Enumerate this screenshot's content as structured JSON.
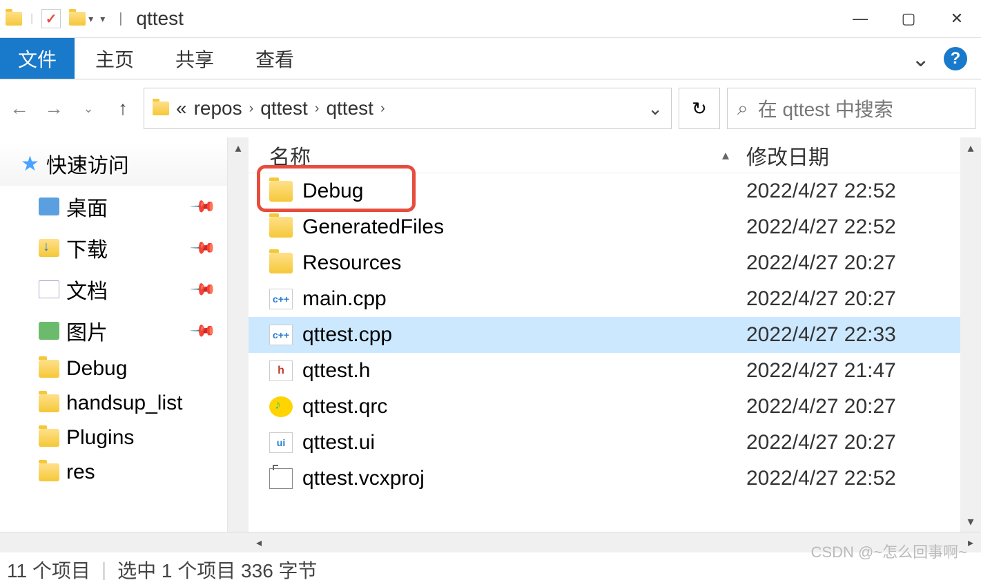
{
  "titlebar": {
    "title": "qttest"
  },
  "ribbon": {
    "file": "文件",
    "tabs": [
      "主页",
      "共享",
      "查看"
    ]
  },
  "nav": {
    "crumbs": [
      "repos",
      "qttest",
      "qttest"
    ],
    "search_placeholder": "在 qttest 中搜索"
  },
  "sidebar": {
    "quick_access": "快速访问",
    "items": [
      {
        "label": "桌面",
        "pinned": true,
        "ico": "desktop"
      },
      {
        "label": "下载",
        "pinned": true,
        "ico": "download"
      },
      {
        "label": "文档",
        "pinned": true,
        "ico": "doc"
      },
      {
        "label": "图片",
        "pinned": true,
        "ico": "pic"
      },
      {
        "label": "Debug",
        "pinned": false,
        "ico": "folder"
      },
      {
        "label": "handsup_list",
        "pinned": false,
        "ico": "folder"
      },
      {
        "label": "Plugins",
        "pinned": false,
        "ico": "folder"
      },
      {
        "label": "res",
        "pinned": false,
        "ico": "folder"
      }
    ]
  },
  "columns": {
    "name": "名称",
    "date": "修改日期"
  },
  "files": [
    {
      "name": "Debug",
      "date": "2022/4/27 22:52",
      "ico": "folder",
      "hl": true
    },
    {
      "name": "GeneratedFiles",
      "date": "2022/4/27 22:52",
      "ico": "folder"
    },
    {
      "name": "Resources",
      "date": "2022/4/27 20:27",
      "ico": "folder"
    },
    {
      "name": "main.cpp",
      "date": "2022/4/27 20:27",
      "ico": "cpp"
    },
    {
      "name": "qttest.cpp",
      "date": "2022/4/27 22:33",
      "ico": "cpp",
      "sel": true
    },
    {
      "name": "qttest.h",
      "date": "2022/4/27 21:47",
      "ico": "h"
    },
    {
      "name": "qttest.qrc",
      "date": "2022/4/27 20:27",
      "ico": "qrc"
    },
    {
      "name": "qttest.ui",
      "date": "2022/4/27 20:27",
      "ico": "ui"
    },
    {
      "name": "qttest.vcxproj",
      "date": "2022/4/27 22:52",
      "ico": "vcx"
    }
  ],
  "status": {
    "count_prefix": "11 个项目",
    "sel": "选中 1 个项目  336 字节"
  },
  "watermark": "CSDN @~怎么回事啊~"
}
